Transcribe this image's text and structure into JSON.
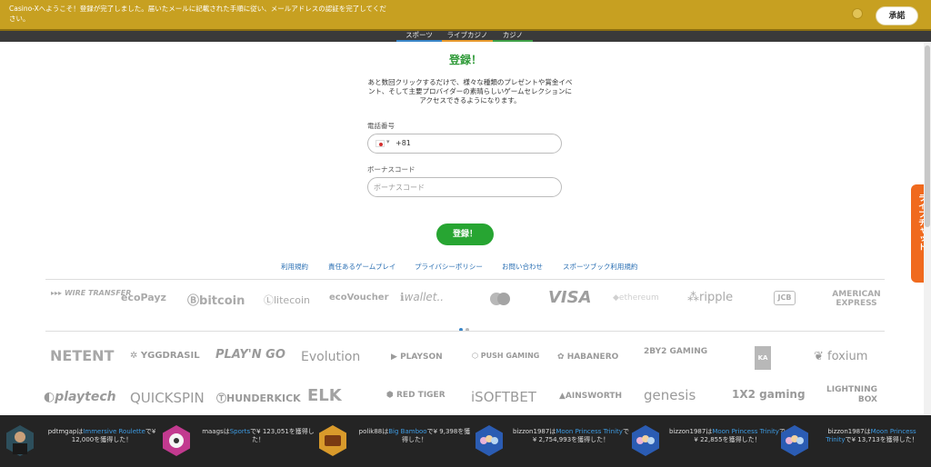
{
  "notice": {
    "text": "Casino-Xへようこそ！登録が完了しました。届いたメールに記載された手順に従い、メールアドレスの認証を完了してください。",
    "accept_label": "承諾"
  },
  "nav": {
    "tabs": [
      {
        "label": "スポーツ",
        "color": "#3a86c8"
      },
      {
        "label": "ライブカジノ",
        "color": "#e89a2e"
      },
      {
        "label": "カジノ",
        "color": "#3fa047"
      }
    ]
  },
  "form": {
    "title": "登録！",
    "description": "あと数回クリックするだけで、様々な種類のプレゼントや賞金イベント、そして主要プロバイダーの素晴らしいゲームセレクションにアクセスできるようになります。",
    "phone_label": "電話番号",
    "phone_value": "+81",
    "country_flag": "japan-flag-icon",
    "bonus_label": "ボーナスコード",
    "bonus_placeholder": "ボーナスコード",
    "submit_label": "登録！",
    "accent_color": "#27a532"
  },
  "footer_links": [
    "利用規約",
    "責任あるゲームプレイ",
    "プライバシーポリシー",
    "お問い合わせ",
    "スポーツブック利用規約"
  ],
  "payments": [
    {
      "name": "wire-transfer",
      "label": "WIRE TRANSFER"
    },
    {
      "name": "ecopayz",
      "label": "ecoPayz"
    },
    {
      "name": "bitcoin",
      "label": "bitcoin"
    },
    {
      "name": "litecoin",
      "label": "litecoin"
    },
    {
      "name": "ecovoucher",
      "label": "ecoVoucher"
    },
    {
      "name": "iwallet",
      "label": "wallet.."
    },
    {
      "name": "mastercard",
      "label": ""
    },
    {
      "name": "visa",
      "label": "VISA"
    },
    {
      "name": "ethereum",
      "label": "ethereum"
    },
    {
      "name": "ripple",
      "label": "ripple"
    },
    {
      "name": "jcb",
      "label": "JCB"
    },
    {
      "name": "american-express",
      "label": "AMERICAN EXPRESS"
    }
  ],
  "providers_row1": [
    {
      "name": "netent",
      "label": "NETENT"
    },
    {
      "name": "yggdrasil",
      "label": "YGGDRASIL"
    },
    {
      "name": "playngo",
      "label": "PLAY'N GO"
    },
    {
      "name": "evolution",
      "label": "Evolution"
    },
    {
      "name": "playson",
      "label": "PLAYSON"
    },
    {
      "name": "push-gaming",
      "label": "PUSH GAMING"
    },
    {
      "name": "habanero",
      "label": "HABANERO"
    },
    {
      "name": "2by2-gaming",
      "label": "2BY2 GAMING"
    },
    {
      "name": "kalamba",
      "label": "KA"
    },
    {
      "name": "foxium",
      "label": "foxium"
    }
  ],
  "providers_row2": [
    {
      "name": "playtech",
      "label": "playtech"
    },
    {
      "name": "quickspin",
      "label": "QUICKSPIN"
    },
    {
      "name": "thunderkick",
      "label": "HUNDERKICK"
    },
    {
      "name": "elk-studios",
      "label": "ELK"
    },
    {
      "name": "red-tiger",
      "label": "RED TIGER"
    },
    {
      "name": "isoftbet",
      "label": "iSOFTBET"
    },
    {
      "name": "ainsworth",
      "label": "AINSWORTH"
    },
    {
      "name": "genesis",
      "label": "genesis"
    },
    {
      "name": "1x2-gaming",
      "label": "1X2 gaming"
    },
    {
      "name": "lightning-box",
      "label": "LIGHTNING BOX"
    }
  ],
  "winners": [
    {
      "user": "pdtmgapは",
      "game": "Immersive Roulette",
      "mid": "で",
      "amount": "¥ 12,000を獲得した！",
      "icon": "roulette-dealer-icon"
    },
    {
      "user": "maagsは",
      "game": "Sports",
      "mid": "で",
      "amount": "¥ 123,051を獲得した！",
      "icon": "sports-icon"
    },
    {
      "user": "polik88は",
      "game": "Big Bamboo",
      "mid": "で",
      "amount": "¥ 9,398を獲得した！",
      "icon": "big-bamboo-icon"
    },
    {
      "user": "bizzon1987は",
      "game": "Moon Princess Trinity",
      "mid": "で",
      "amount": "¥ 2,754,993を獲得した！",
      "icon": "moon-princess-icon"
    },
    {
      "user": "bizzon1987は",
      "game": "Moon Princess Trinity",
      "mid": "で",
      "amount": "¥ 22,855を獲得した！",
      "icon": "moon-princess-icon"
    },
    {
      "user": "bizzon1987は",
      "game": "Moon Princess Trinity",
      "mid": "で",
      "amount": "¥ 13,713を獲得した！",
      "icon": "moon-princess-icon"
    }
  ],
  "livechat": {
    "label": "ライブチャット",
    "color": "#f06a1e"
  }
}
